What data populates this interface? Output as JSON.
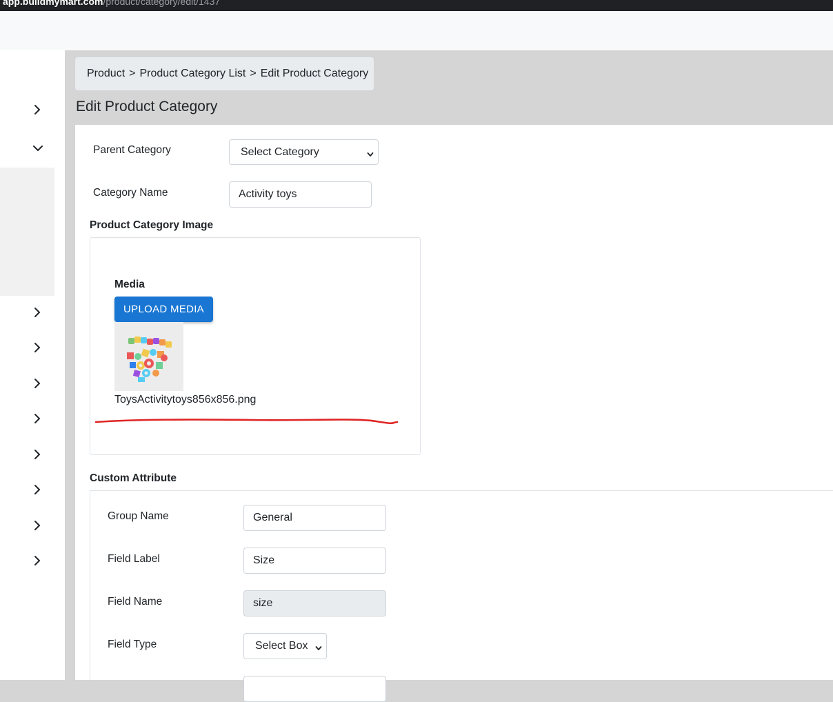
{
  "browser": {
    "url_host": "app.buildmymart.com",
    "url_path": "/product/category/edit/1437"
  },
  "breadcrumb": {
    "items": [
      "Product",
      "Product Category List",
      "Edit Product Category"
    ],
    "separator": ">"
  },
  "page": {
    "title": "Edit Product Category"
  },
  "form": {
    "parent_category": {
      "label": "Parent Category",
      "value": "Select Category"
    },
    "category_name": {
      "label": "Category Name",
      "value": "Activity toys"
    }
  },
  "image_section": {
    "heading": "Product Category Image",
    "media_label": "Media",
    "upload_button": "UPLOAD MEDIA",
    "filename": "ToysActivitytoys856x856.png"
  },
  "custom_attribute": {
    "heading": "Custom Attribute",
    "group_name": {
      "label": "Group Name",
      "value": "General"
    },
    "field_label": {
      "label": "Field Label",
      "value": "Size"
    },
    "field_name": {
      "label": "Field Name",
      "value": "size"
    },
    "field_type": {
      "label": "Field Type",
      "value": "Select Box"
    }
  },
  "colors": {
    "primary_button": "#1976d2",
    "annotation_red": "#e02424",
    "breadcrumb_bg": "#e9ecef",
    "page_bg": "#d5d5d5"
  },
  "icons": {
    "sidebar_toggles": [
      "chevron-right-icon",
      "chevron-down-icon",
      "chevron-right-icon",
      "chevron-right-icon",
      "chevron-right-icon",
      "chevron-right-icon",
      "chevron-right-icon",
      "chevron-right-icon",
      "chevron-right-icon",
      "chevron-right-icon"
    ]
  }
}
